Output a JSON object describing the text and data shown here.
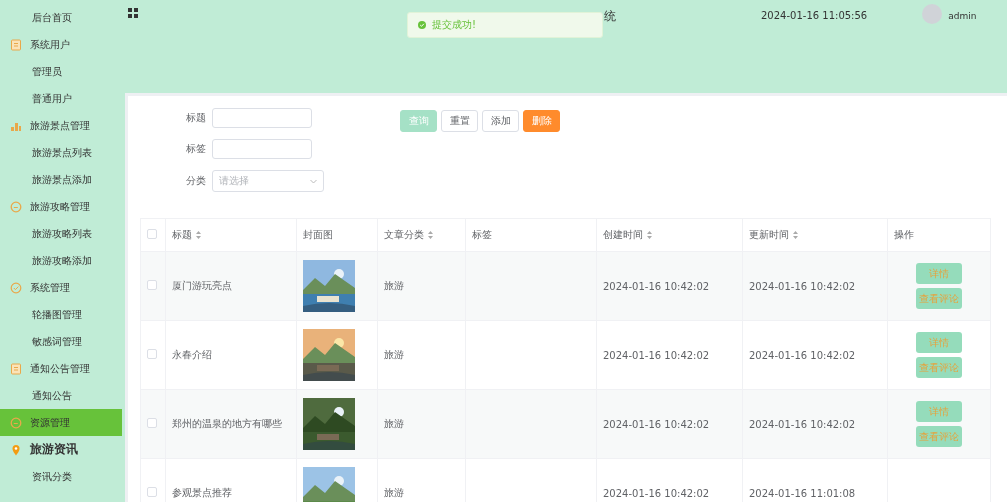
{
  "sidebar": {
    "items": [
      {
        "label": "后台首页",
        "selected": false,
        "kind": "child"
      },
      {
        "label": "系统用户",
        "selected": false,
        "kind": "users"
      },
      {
        "label": "管理员",
        "selected": false,
        "kind": "child"
      },
      {
        "label": "普通用户",
        "selected": false,
        "kind": "child"
      },
      {
        "label": "旅游景点管理",
        "selected": false,
        "kind": "places"
      },
      {
        "label": "旅游景点列表",
        "selected": false,
        "kind": "child"
      },
      {
        "label": "旅游景点添加",
        "selected": false,
        "kind": "child"
      },
      {
        "label": "旅游攻略管理",
        "selected": false,
        "kind": "guides"
      },
      {
        "label": "旅游攻略列表",
        "selected": false,
        "kind": "child"
      },
      {
        "label": "旅游攻略添加",
        "selected": false,
        "kind": "child"
      },
      {
        "label": "系统管理",
        "selected": false,
        "kind": "system"
      },
      {
        "label": "轮播图管理",
        "selected": false,
        "kind": "child"
      },
      {
        "label": "敏感词管理",
        "selected": false,
        "kind": "child"
      },
      {
        "label": "通知公告管理",
        "selected": false,
        "kind": "notices"
      },
      {
        "label": "通知公告",
        "selected": false,
        "kind": "child"
      },
      {
        "label": "资源管理",
        "selected": true,
        "kind": "guides"
      },
      {
        "label": "旅游资讯",
        "selected": false,
        "kind": "heading"
      },
      {
        "label": "资讯分类",
        "selected": false,
        "kind": "child"
      }
    ]
  },
  "header": {
    "title": "统",
    "datetime": "2024-01-16 11:05:56",
    "user": "admin"
  },
  "toast": {
    "message": "提交成功!"
  },
  "filters": [
    {
      "label": "标题",
      "kind": "text"
    },
    {
      "label": "标签",
      "kind": "text"
    },
    {
      "label": "分类",
      "kind": "select",
      "placeholder": "请选择"
    }
  ],
  "actions": [
    {
      "label": "查询",
      "kind": "primary"
    },
    {
      "label": "重置",
      "kind": "plain"
    },
    {
      "label": "添加",
      "kind": "plain"
    },
    {
      "label": "删除",
      "kind": "danger"
    }
  ],
  "table": {
    "all_checked": false,
    "columns": [
      {
        "label": "标题",
        "sortable": true
      },
      {
        "label": "封面图",
        "sortable": false
      },
      {
        "label": "文章分类",
        "sortable": true
      },
      {
        "label": "标签",
        "sortable": false
      },
      {
        "label": "创建时间",
        "sortable": true
      },
      {
        "label": "更新时间",
        "sortable": true
      },
      {
        "label": "操作",
        "sortable": false
      }
    ],
    "rows": [
      {
        "checked": false,
        "title": "厦门游玩亮点",
        "cover": {
          "kind": "picture"
        },
        "category": "旅游",
        "created": "2024-01-16 10:42:02",
        "updated": "2024-01-16 10:42:02",
        "buttons": [
          "详情",
          "查看评论"
        ]
      },
      {
        "checked": false,
        "title": "永春介绍",
        "cover": {
          "kind": "picture"
        },
        "category": "旅游",
        "created": "2024-01-16 10:42:02",
        "updated": "2024-01-16 10:42:02",
        "buttons": [
          "详情",
          "查看评论"
        ]
      },
      {
        "checked": false,
        "title": "郑州的温泉的地方有哪些",
        "cover": {
          "kind": "picture"
        },
        "category": "旅游",
        "created": "2024-01-16 10:42:02",
        "updated": "2024-01-16 10:42:02",
        "buttons": [
          "详情",
          "查看评论"
        ]
      },
      {
        "checked": false,
        "title": "参观景点推荐",
        "cover": {
          "kind": "picture"
        },
        "category": "旅游",
        "created": "2024-01-16 10:42:02",
        "updated": "2024-01-16 11:01:08",
        "buttons": []
      }
    ]
  }
}
